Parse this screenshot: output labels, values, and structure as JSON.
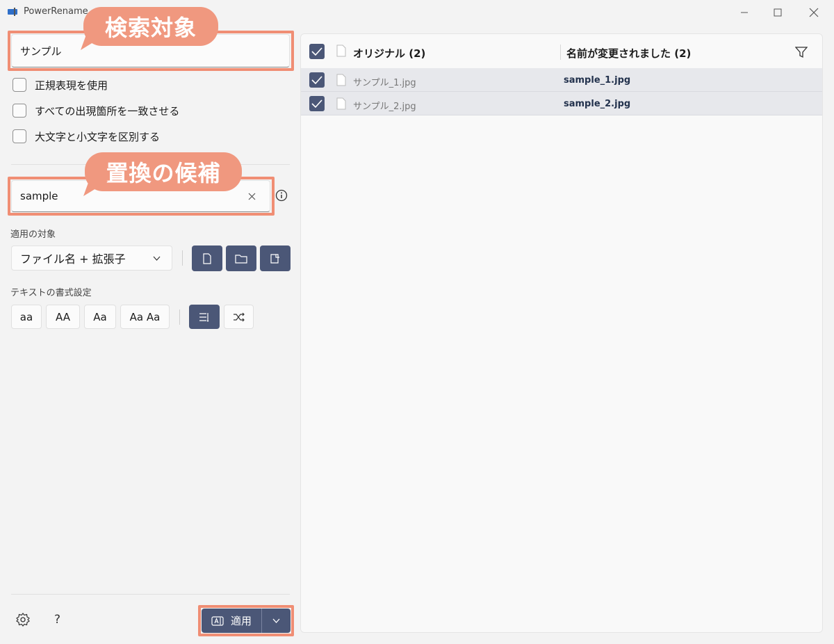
{
  "app": {
    "title": "PowerRename"
  },
  "search": {
    "value": "サンプル",
    "callout": "検索対象"
  },
  "options": [
    {
      "label": "正規表現を使用"
    },
    {
      "label": "すべての出現箇所を一致させる"
    },
    {
      "label": "大文字と小文字を区別する"
    }
  ],
  "replace": {
    "value": "sample",
    "callout": "置換の候補"
  },
  "apply_to": {
    "label": "適用の対象",
    "selected": "ファイル名 + 拡張子"
  },
  "text_format": {
    "label": "テキストの書式設定",
    "buttons": [
      "aa",
      "AA",
      "Aa",
      "Aa Aa"
    ]
  },
  "footer": {
    "help": "?",
    "apply_label": "適用"
  },
  "list": {
    "header_original": "オリジナル (2)",
    "header_renamed": "名前が変更されました (2)",
    "rows": [
      {
        "original": "サンプル_1.jpg",
        "renamed": "sample_1.jpg"
      },
      {
        "original": "サンプル_2.jpg",
        "renamed": "sample_2.jpg"
      }
    ]
  },
  "colors": {
    "accent": "#4b5777",
    "highlight": "#f08e74"
  }
}
